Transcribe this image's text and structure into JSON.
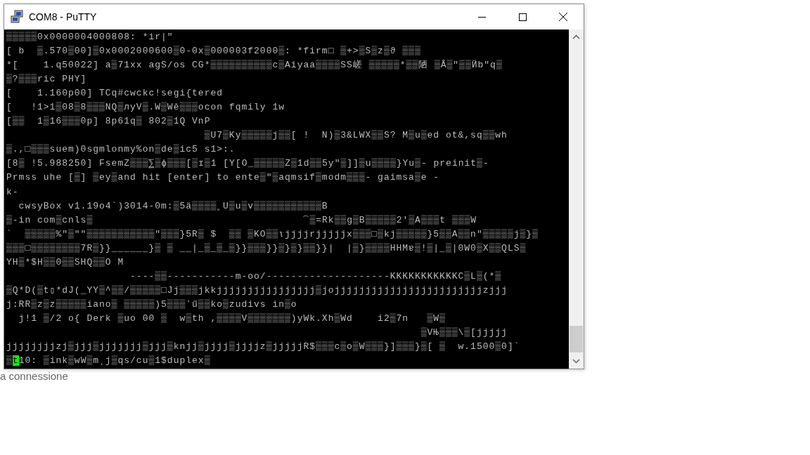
{
  "window": {
    "title": "COM8 - PuTTY"
  },
  "terminal": {
    "lines": [
      "▒▒▒▒▒0x0000004000808: *ir|\"",
      "[ b  ▒.570▒00]▒0x0002000600▒0-0x▒000003f2000▒: *firm□ ▒+>▒S▒z▒ϑ ▒▒▒",
      "*[    1.q50022] a▒71xx agS/os CG*▒▒▒▒▒▒▒▒▒▒c▒Aiyaa▒▒▒▒SS嵯 ▒▒▒▒▒*▒▒陋 ▒Â▒\"▒▒Йb\"q▒",
      "▒?▒▒▒ric PHY]",
      "[    1.160p00] TCq#cwckc!segi{tered",
      "[   !1>1▒08▒8▒▒▒NQ▒лyV▒.W▒Wě▒▒▒ocon fqmily 1w",
      "[▒▒  1▒16▒▒▒0p] 8p61q▒ 802▒1Q VnP",
      "                                ▒U7▒Ky▒▒▒▒▒j▒▒[ !  N)▒3&LWX▒▒S? M▒u▒ed ot&,sq▒▒wh",
      "▒.,□▒▒▒suem)0sgmlonmy%on▒de▒ic5 s1>:.",
      "[8▒ !5.988250] FsemZ▒▒▒⅀▒ɸ▒▒▒[▒ɪ▒1 [Y[O_▒▒▒▒▒Z▒1d▒▒5y\"▒]]▒u▒▒▒▒}Yu▒- preinit▒-",
      "Prmss uhe [▒] ▒ey▒and hit [enter] to ente▒\"▒aqmsif▒modm▒▒▒- gaimsa▒e -",
      "k-",
      "  cwsyBox v1.19o4`)3014-0m:▒5ä▒▒▒▒˳U▒u▒v▒▒▒▒▒▒▒▒▒▒▒B",
      "▒-in com▒cnls▒                                  ⁀▒=Rk▒▒g▒B▒▒▒▒▒2ʹ▒A▒▒▒t ▒▒▒W",
      "`  ▒▒▒▒▒%\"▒\"\"▒▒▒▒▒▒▒▒▒▒▒\"▒▒▒}5R▒ $  ▒▒ ▒KO▒▒ɩjjjjrjjjjjx▒▒▒□▒kj▒▒▒▒▒}5▒▒A▒▒n\"▒▒▒▒▒j▒}▒",
      "▒▒▒□▒▒▒▒▒▒▒▒7R▒}}______}▒ ▒ __|_▒_▒_▒}}▒▒▒}}▒}▒}▒▒}}|  |▒}▒▒▒▒HHMɐ▒!▒|_▒|0W0▒X▒▒QLS▒",
      "YH▒*$H▒▒0▒▒SHQ▒▒O M",
      "                    ----▒▒-----------m-oo/--------------------KKKKKKKKKKKC▒L▒(*▒",
      "▒Q*D(▒t▯*dJ(_YY▒^▒▒/▒▒▒▒▒□Jj▒▒▒jkkjjjjjjjjjjjjjjjj▒jojjjjjjjjjjjjjjjjjjjjjjjjzjjj",
      "j:RR▒z▒z▒▒▒▒▒iano▒ ▒▒▒▒▒)5▒▒▒ʻű▒▒ko▒zudivs in▒o",
      "  j!1 ▒/2 o{ Derk ▒uo 00 ▒  w▒th ,▒▒▒▒V▒▒▒▒▒▒▒)yWk.Xh▒Wd    i2▒7n   ▒W▒",
      "                                                                   ▒VЊ▒▒▒\\▒[jjjjj",
      "jjjjjjjjzj▒jjj▒jjjjjjj▒jjj▒knjj▒jjjj▒jjjjz▒jjjjjR$▒▒▒c▒o▒W▒▒▒}]▒▒▒}▒[ ▒  w.1500▒0]`"
    ],
    "cursor_line": {
      "before": "▒",
      "cursor": "t",
      "after": "10: ▒ink▒wW▒m˛j▒qs/cu▒1$duplex▒"
    }
  },
  "background_text": "a connessione"
}
